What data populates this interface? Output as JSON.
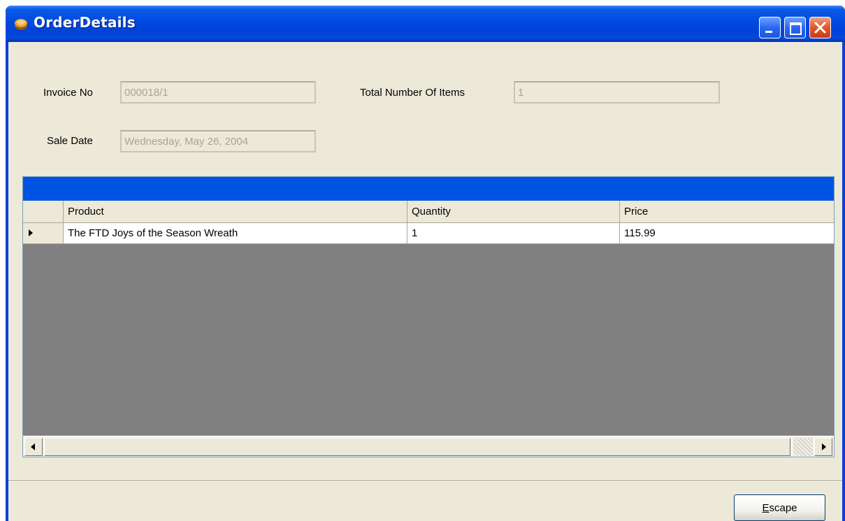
{
  "window": {
    "title": "OrderDetails"
  },
  "form": {
    "invoice_label": "Invoice No",
    "invoice_value": "000018/1",
    "total_items_label": "Total Number Of Items",
    "total_items_value": "1",
    "sale_date_label": "Sale Date",
    "sale_date_value": "Wednesday, May 26, 2004"
  },
  "grid": {
    "columns": [
      "Product",
      "Quantity",
      "Price"
    ],
    "rows": [
      {
        "product": "The FTD Joys of the Season Wreath",
        "quantity": "1",
        "price": "115.99"
      }
    ]
  },
  "buttons": {
    "escape_accel": "E",
    "escape_rest": "scape"
  },
  "colors": {
    "titlebar": "#0049e0",
    "client_bg": "#ece9d8",
    "grid_caption": "#0054e3",
    "grid_empty": "#808080",
    "close_button": "#e0562a"
  }
}
